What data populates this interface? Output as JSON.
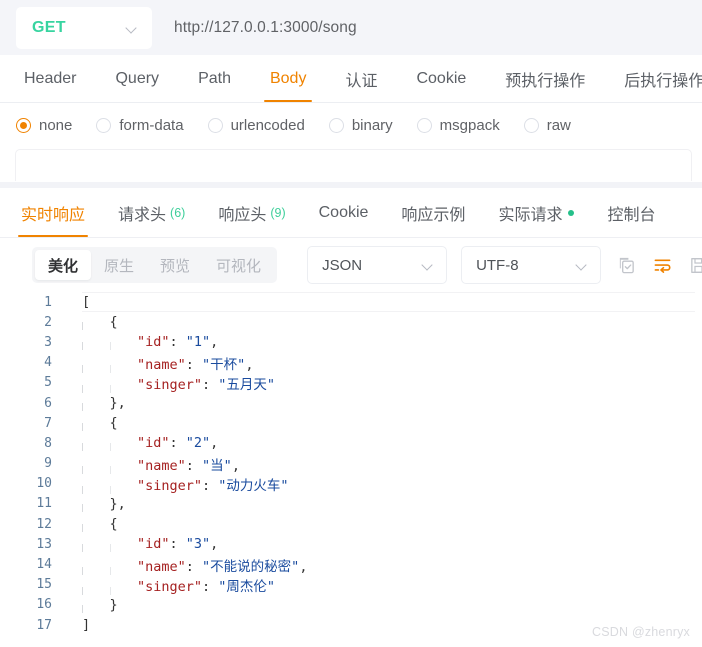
{
  "request_bar": {
    "method": "GET",
    "method_chevron_icon": "chevron-down-icon",
    "url": "http://127.0.0.1:3000/song"
  },
  "request_tabs": [
    {
      "label": "Header",
      "active": false
    },
    {
      "label": "Query",
      "active": false
    },
    {
      "label": "Path",
      "active": false
    },
    {
      "label": "Body",
      "active": true
    },
    {
      "label": "认证",
      "active": false
    },
    {
      "label": "Cookie",
      "active": false
    },
    {
      "label": "预执行操作",
      "active": false
    },
    {
      "label": "后执行操作",
      "active": false
    }
  ],
  "body_types": [
    {
      "label": "none",
      "checked": true
    },
    {
      "label": "form-data",
      "checked": false
    },
    {
      "label": "urlencoded",
      "checked": false
    },
    {
      "label": "binary",
      "checked": false
    },
    {
      "label": "msgpack",
      "checked": false
    },
    {
      "label": "raw",
      "checked": false
    }
  ],
  "response_tabs": [
    {
      "label": "实时响应",
      "badge": "",
      "dot": false,
      "active": true
    },
    {
      "label": "请求头",
      "badge": "(6)",
      "dot": false,
      "active": false
    },
    {
      "label": "响应头",
      "badge": "(9)",
      "dot": false,
      "active": false
    },
    {
      "label": "Cookie",
      "badge": "",
      "dot": false,
      "active": false
    },
    {
      "label": "响应示例",
      "badge": "",
      "dot": false,
      "active": false
    },
    {
      "label": "实际请求",
      "badge": "",
      "dot": true,
      "active": false
    },
    {
      "label": "控制台",
      "badge": "",
      "dot": false,
      "active": false
    }
  ],
  "view_toolbar": {
    "segments": [
      {
        "label": "美化",
        "active": true
      },
      {
        "label": "原生",
        "active": false
      },
      {
        "label": "预览",
        "active": false
      },
      {
        "label": "可视化",
        "active": false
      }
    ],
    "format_select": {
      "value": "JSON",
      "chevron_icon": "chevron-down-icon"
    },
    "encoding_select": {
      "value": "UTF-8",
      "chevron_icon": "chevron-down-icon"
    },
    "actions": [
      {
        "icon": "copy-icon",
        "color": "#b9bcc3"
      },
      {
        "icon": "word-wrap-icon",
        "color": "#f08300"
      },
      {
        "icon": "save-icon",
        "color": "#b9bcc3"
      }
    ]
  },
  "editor": {
    "line_numbers": [
      "1",
      "2",
      "3",
      "4",
      "5",
      "6",
      "7",
      "8",
      "9",
      "10",
      "11",
      "12",
      "13",
      "14",
      "15",
      "16",
      "17"
    ],
    "response_json": [
      {
        "id": "1",
        "name": "干杯",
        "singer": "五月天"
      },
      {
        "id": "2",
        "name": "当",
        "singer": "动力火车"
      },
      {
        "id": "3",
        "name": "不能说的秘密",
        "singer": "周杰伦"
      }
    ],
    "raw_lines": [
      "[",
      "    {",
      "        \"id\": \"1\",",
      "        \"name\": \"干杯\",",
      "        \"singer\": \"五月天\"",
      "    },",
      "    {",
      "        \"id\": \"2\",",
      "        \"name\": \"当\",",
      "        \"singer\": \"动力火车\"",
      "    },",
      "    {",
      "        \"id\": \"3\",",
      "        \"name\": \"不能说的秘密\",",
      "        \"singer\": \"周杰伦\"",
      "    }",
      "]"
    ],
    "tokens": {
      "key_id": "\"id\"",
      "key_name": "\"name\"",
      "key_singer": "\"singer\"",
      "colon": ": ",
      "comma": ",",
      "open_bracket": "[",
      "close_bracket": "]",
      "open_brace": "{",
      "close_brace": "}",
      "close_brace_comma": "},",
      "v_id_1": "\"1\"",
      "v_id_2": "\"2\"",
      "v_id_3": "\"3\"",
      "v_name_1": "\"干杯\"",
      "v_name_2": "\"当\"",
      "v_name_3": "\"不能说的秘密\"",
      "v_singer_1": "\"五月天\"",
      "v_singer_2": "\"动力火车\"",
      "v_singer_3": "\"周杰伦\""
    }
  },
  "watermark": "CSDN @zhenryx",
  "colors": {
    "accent_orange": "#f08300",
    "method_green": "#37d4a0",
    "badge_green": "#3ecf9a",
    "json_key": "#a52121",
    "json_string": "#1a4b9e",
    "linenumber": "#5d7b99"
  }
}
